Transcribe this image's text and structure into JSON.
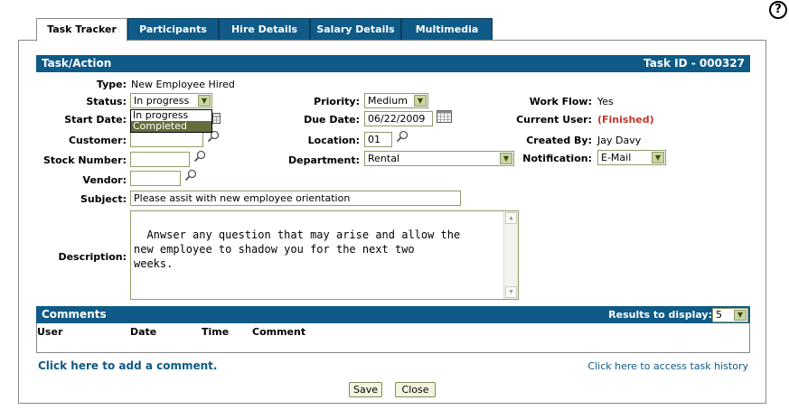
{
  "help": {
    "label": "?"
  },
  "tabs": [
    {
      "label": "Task Tracker"
    },
    {
      "label": "Participants"
    },
    {
      "label": "Hire Details"
    },
    {
      "label": "Salary Details"
    },
    {
      "label": "Multimedia"
    }
  ],
  "task": {
    "header": "Task/Action",
    "task_id": "Task ID - 000327",
    "type_label": "Type:",
    "type_value": "New Employee Hired",
    "status_label": "Status:",
    "status_value": "In progress",
    "status_options": [
      "In progress",
      "Completed"
    ],
    "start_date_label": "Start Date:",
    "customer_label": "Customer:",
    "stock_label": "Stock Number:",
    "vendor_label": "Vendor:",
    "subject_label": "Subject:",
    "subject_value": "Please assit with new employee orientation",
    "description_label": "Description:",
    "description_value": "Anwser any question that may arise and allow the\nnew employee to shadow you for the next two\nweeks.",
    "priority_label": "Priority:",
    "priority_value": "Medium",
    "due_date_label": "Due Date:",
    "due_date_value": "06/22/2009",
    "location_label": "Location:",
    "location_value": "01",
    "department_label": "Department:",
    "department_value": "Rental",
    "workflow_label": "Work Flow:",
    "workflow_value": "Yes",
    "current_user_label": "Current User:",
    "current_user_value": "(Finished)",
    "created_by_label": "Created By:",
    "created_by_value": "Jay Davy",
    "notification_label": "Notification:",
    "notification_value": "E-Mail"
  },
  "comments": {
    "header": "Comments",
    "results_label": "Results to display:",
    "results_value": "5",
    "columns": [
      "User",
      "Date",
      "Time",
      "Comment"
    ]
  },
  "links": {
    "add_comment": "Click here to add a comment.",
    "task_history": "Click here to access task history"
  },
  "buttons": {
    "save": "Save",
    "close": "Close"
  },
  "colors": {
    "accent": "#0f5a87",
    "finished": "#c0392b",
    "field_border": "#8f9c6a"
  }
}
